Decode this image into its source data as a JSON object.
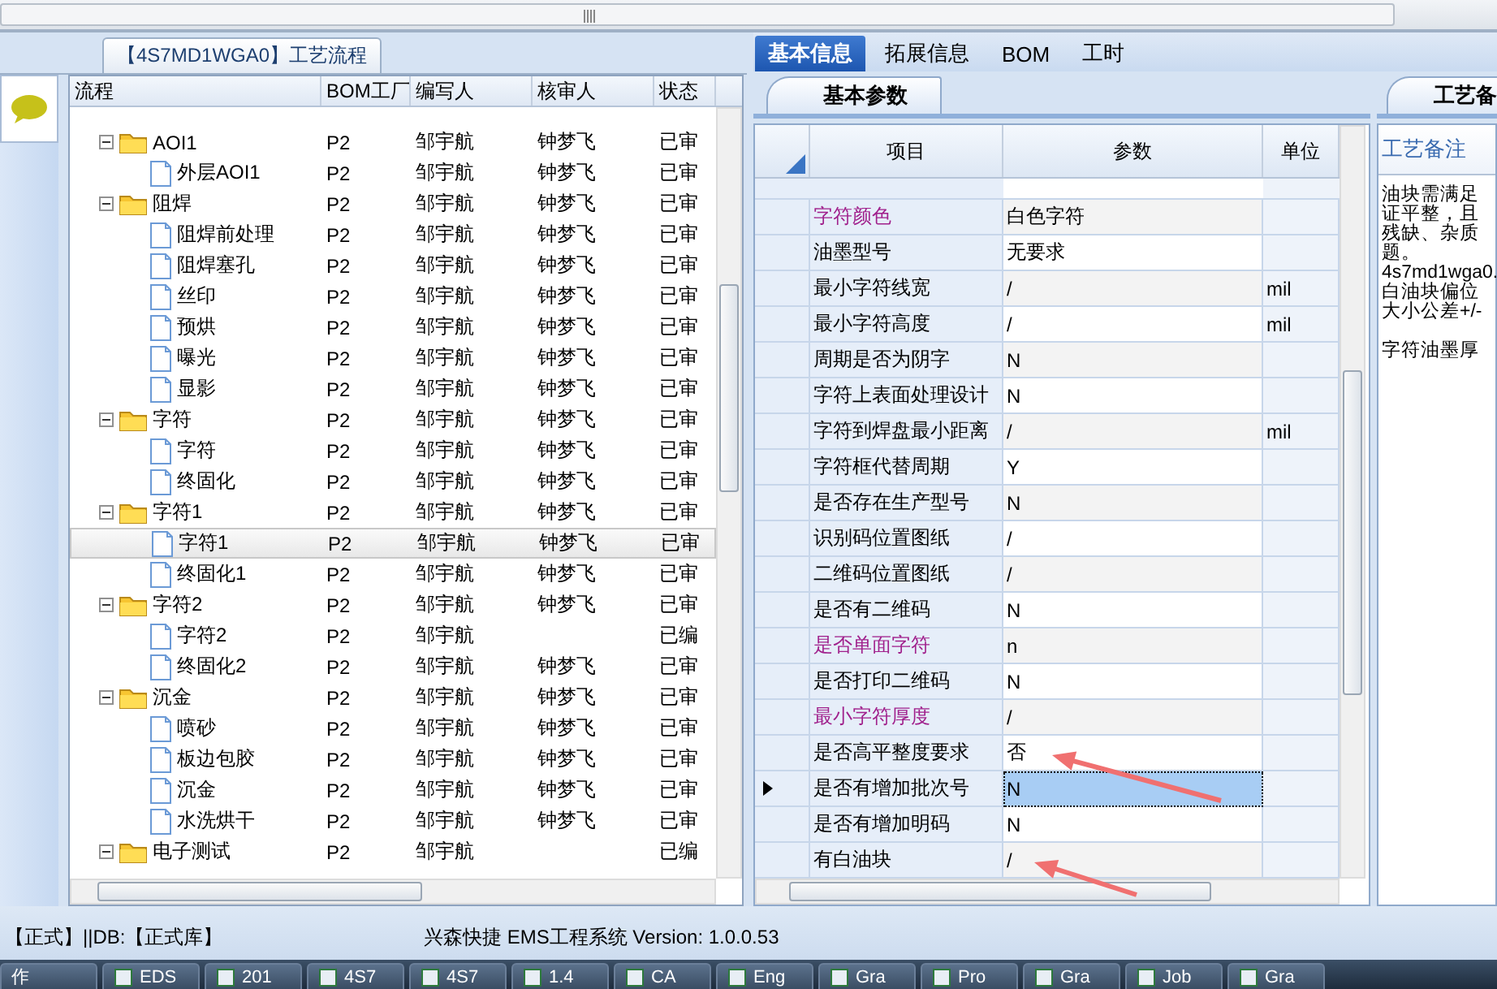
{
  "tree": {
    "tab": "【4S7MD1WGA0】工艺流程",
    "columns": [
      "流程",
      "BOM工厂",
      "编写人",
      "核审人",
      "状态"
    ],
    "rows": [
      {
        "label": "AOI1",
        "kind": "folder",
        "expanded": true,
        "selected": false,
        "bom": "P2",
        "author": "邹宇航",
        "reviewer": "钟梦飞",
        "status": "已审",
        "children": [
          {
            "label": "外层AOI1",
            "kind": "file",
            "selected": false,
            "bom": "P2",
            "author": "邹宇航",
            "reviewer": "钟梦飞",
            "status": "已审"
          }
        ]
      },
      {
        "label": "阻焊",
        "kind": "folder",
        "expanded": true,
        "selected": false,
        "bom": "P2",
        "author": "邹宇航",
        "reviewer": "钟梦飞",
        "status": "已审",
        "children": [
          {
            "label": "阻焊前处理",
            "kind": "file",
            "selected": false,
            "bom": "P2",
            "author": "邹宇航",
            "reviewer": "钟梦飞",
            "status": "已审"
          },
          {
            "label": "阻焊塞孔",
            "kind": "file",
            "selected": false,
            "bom": "P2",
            "author": "邹宇航",
            "reviewer": "钟梦飞",
            "status": "已审"
          },
          {
            "label": "丝印",
            "kind": "file",
            "selected": false,
            "bom": "P2",
            "author": "邹宇航",
            "reviewer": "钟梦飞",
            "status": "已审"
          },
          {
            "label": "预烘",
            "kind": "file",
            "selected": false,
            "bom": "P2",
            "author": "邹宇航",
            "reviewer": "钟梦飞",
            "status": "已审"
          },
          {
            "label": "曝光",
            "kind": "file",
            "selected": false,
            "bom": "P2",
            "author": "邹宇航",
            "reviewer": "钟梦飞",
            "status": "已审"
          },
          {
            "label": "显影",
            "kind": "file",
            "selected": false,
            "bom": "P2",
            "author": "邹宇航",
            "reviewer": "钟梦飞",
            "status": "已审"
          }
        ]
      },
      {
        "label": "字符",
        "kind": "folder",
        "expanded": true,
        "selected": false,
        "bom": "P2",
        "author": "邹宇航",
        "reviewer": "钟梦飞",
        "status": "已审",
        "children": [
          {
            "label": "字符",
            "kind": "file",
            "selected": false,
            "bom": "P2",
            "author": "邹宇航",
            "reviewer": "钟梦飞",
            "status": "已审"
          },
          {
            "label": "终固化",
            "kind": "file",
            "selected": false,
            "bom": "P2",
            "author": "邹宇航",
            "reviewer": "钟梦飞",
            "status": "已审"
          }
        ]
      },
      {
        "label": "字符1",
        "kind": "folder",
        "expanded": true,
        "selected": false,
        "bom": "P2",
        "author": "邹宇航",
        "reviewer": "钟梦飞",
        "status": "已审",
        "children": [
          {
            "label": "字符1",
            "kind": "file",
            "selected": true,
            "bom": "P2",
            "author": "邹宇航",
            "reviewer": "钟梦飞",
            "status": "已审"
          },
          {
            "label": "终固化1",
            "kind": "file",
            "selected": false,
            "bom": "P2",
            "author": "邹宇航",
            "reviewer": "钟梦飞",
            "status": "已审"
          }
        ]
      },
      {
        "label": "字符2",
        "kind": "folder",
        "expanded": true,
        "selected": false,
        "bom": "P2",
        "author": "邹宇航",
        "reviewer": "钟梦飞",
        "status": "已审",
        "children": [
          {
            "label": "字符2",
            "kind": "file",
            "selected": false,
            "bom": "P2",
            "author": "邹宇航",
            "status": "已编"
          },
          {
            "label": "终固化2",
            "kind": "file",
            "selected": false,
            "bom": "P2",
            "author": "邹宇航",
            "reviewer": "钟梦飞",
            "status": "已审"
          }
        ]
      },
      {
        "label": "沉金",
        "kind": "folder",
        "expanded": true,
        "selected": false,
        "bom": "P2",
        "author": "邹宇航",
        "reviewer": "钟梦飞",
        "status": "已审",
        "children": [
          {
            "label": "喷砂",
            "kind": "file",
            "selected": false,
            "bom": "P2",
            "author": "邹宇航",
            "reviewer": "钟梦飞",
            "status": "已审"
          },
          {
            "label": "板边包胶",
            "kind": "file",
            "selected": false,
            "bom": "P2",
            "author": "邹宇航",
            "reviewer": "钟梦飞",
            "status": "已审"
          },
          {
            "label": "沉金",
            "kind": "file",
            "selected": false,
            "bom": "P2",
            "author": "邹宇航",
            "reviewer": "钟梦飞",
            "status": "已审"
          },
          {
            "label": "水洗烘干",
            "kind": "file",
            "selected": false,
            "bom": "P2",
            "author": "邹宇航",
            "reviewer": "钟梦飞",
            "status": "已审"
          }
        ]
      },
      {
        "label": "电子测试",
        "kind": "folder",
        "expanded": true,
        "selected": false,
        "bom": "P2",
        "author": "邹宇航",
        "status": "已编",
        "children": []
      }
    ]
  },
  "tabs": [
    {
      "label": "基本信息",
      "selected": true
    },
    {
      "label": "拓展信息",
      "selected": false
    },
    {
      "label": "BOM",
      "selected": false
    },
    {
      "label": "工时",
      "selected": false
    }
  ],
  "subtab": {
    "label": "基本参数"
  },
  "grid": {
    "columns": [
      "项目",
      "参数",
      "单位"
    ],
    "rows": [
      {
        "item": "字符颜色",
        "value": "白色字符",
        "color": "#a0208c",
        "selected": false
      },
      {
        "item": "油墨型号",
        "value": "无要求",
        "color": "#000000",
        "selected": false
      },
      {
        "item": "最小字符线宽",
        "value": "/",
        "unit": "mil",
        "color": "#000000",
        "selected": false
      },
      {
        "item": "最小字符高度",
        "value": "/",
        "unit": "mil",
        "color": "#000000",
        "selected": false
      },
      {
        "item": "周期是否为阴字",
        "value": "N",
        "color": "#000000",
        "selected": false
      },
      {
        "item": "字符上表面处理设计",
        "value": "N",
        "color": "#000000",
        "selected": false
      },
      {
        "item": "字符到焊盘最小距离",
        "value": "/",
        "unit": "mil",
        "color": "#000000",
        "selected": false
      },
      {
        "item": "字符框代替周期",
        "value": "Y",
        "color": "#000000",
        "selected": false
      },
      {
        "item": "是否存在生产型号",
        "value": "N",
        "color": "#000000",
        "selected": false
      },
      {
        "item": "识别码位置图纸",
        "value": "/",
        "color": "#000000",
        "selected": false
      },
      {
        "item": "二维码位置图纸",
        "value": "/",
        "color": "#000000",
        "selected": false
      },
      {
        "item": "是否有二维码",
        "value": "N",
        "color": "#000000",
        "selected": false
      },
      {
        "item": "是否单面字符",
        "value": "n",
        "color": "#a0208c",
        "selected": false
      },
      {
        "item": "是否打印二维码",
        "value": "N",
        "color": "#000000",
        "selected": false
      },
      {
        "item": "最小字符厚度",
        "value": "/",
        "color": "#a0208c",
        "selected": false
      },
      {
        "item": "是否高平整度要求",
        "value": "否",
        "color": "#000000",
        "selected": false
      },
      {
        "item": "是否有增加批次号",
        "value": "N",
        "color": "#000000",
        "selected": true
      },
      {
        "item": "是否有增加明码",
        "value": "N",
        "color": "#000000",
        "selected": false
      },
      {
        "item": "有白油块",
        "value": "/",
        "color": "#000000",
        "selected": false
      }
    ]
  },
  "notes": {
    "tab": "工艺备",
    "label": "工艺备注",
    "paragraphs": [
      [
        "油块需满足",
        "证平整，且",
        "残缺、杂质",
        "题。",
        "4s7md1wga0.",
        "白油块偏位",
        "大小公差+/-"
      ],
      [
        "字符油墨厚"
      ]
    ]
  },
  "status_bar": {
    "left": "【正式】||DB:【正式库】",
    "center": "兴森快捷 EMS工程系统 Version: 1.0.0.53"
  },
  "taskbar": [
    {
      "label": "作"
    },
    {
      "label": "EDS"
    },
    {
      "label": "201"
    },
    {
      "label": "4S7"
    },
    {
      "label": "4S7"
    },
    {
      "label": "1.4"
    },
    {
      "label": "CA"
    },
    {
      "label": "Eng"
    },
    {
      "label": "Gra"
    },
    {
      "label": "Pro"
    },
    {
      "label": "Gra"
    },
    {
      "label": "Job"
    },
    {
      "label": "Gra"
    }
  ]
}
